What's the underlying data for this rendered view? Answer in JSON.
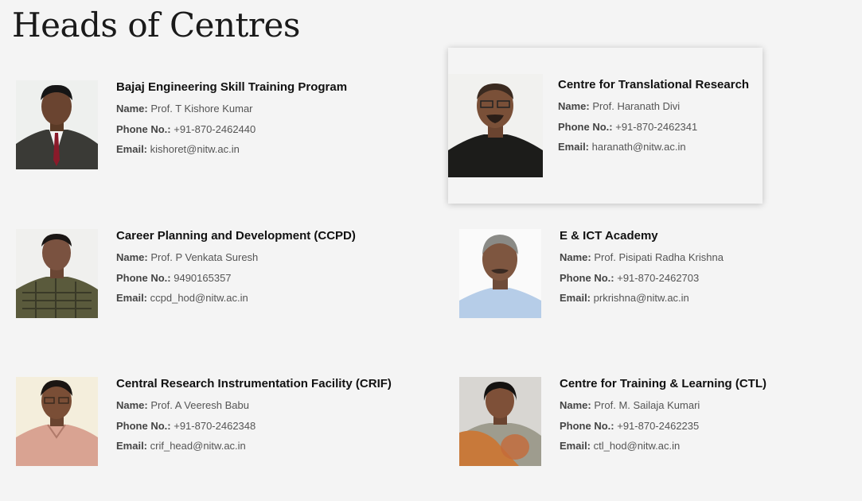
{
  "page": {
    "title": "Heads of Centres"
  },
  "labels": {
    "name": "Name:",
    "phone": "Phone No.:",
    "email": "Email:"
  },
  "centres": [
    {
      "centre": "Bajaj Engineering Skill Training Program",
      "name": "Prof. T Kishore Kumar",
      "phone": "+91-870-2462440",
      "email": "kishoret@nitw.ac.in"
    },
    {
      "centre": "Centre for Translational Research",
      "name": "Prof. Haranath Divi",
      "phone": "+91-870-2462341",
      "email": "haranath@nitw.ac.in"
    },
    {
      "centre": "Career Planning and Development (CCPD)",
      "name": "Prof. P Venkata Suresh",
      "phone": "9490165357",
      "email": "ccpd_hod@nitw.ac.in"
    },
    {
      "centre": "E & ICT Academy",
      "name": "Prof. Pisipati Radha Krishna",
      "phone": "+91-870-2462703",
      "email": "prkrishna@nitw.ac.in"
    },
    {
      "centre": "Central Research Instrumentation Facility (CRIF)",
      "name": "Prof. A Veeresh Babu",
      "phone": "+91-870-2462348",
      "email": "crif_head@nitw.ac.in"
    },
    {
      "centre": "Centre for Training & Learning (CTL)",
      "name": "Prof. M. Sailaja Kumari",
      "phone": "+91-870-2462235",
      "email": "ctl_hod@nitw.ac.in"
    }
  ],
  "colors": {
    "background": "#f4f4f4",
    "heading": "#1a1a1a",
    "text": "#555555"
  }
}
